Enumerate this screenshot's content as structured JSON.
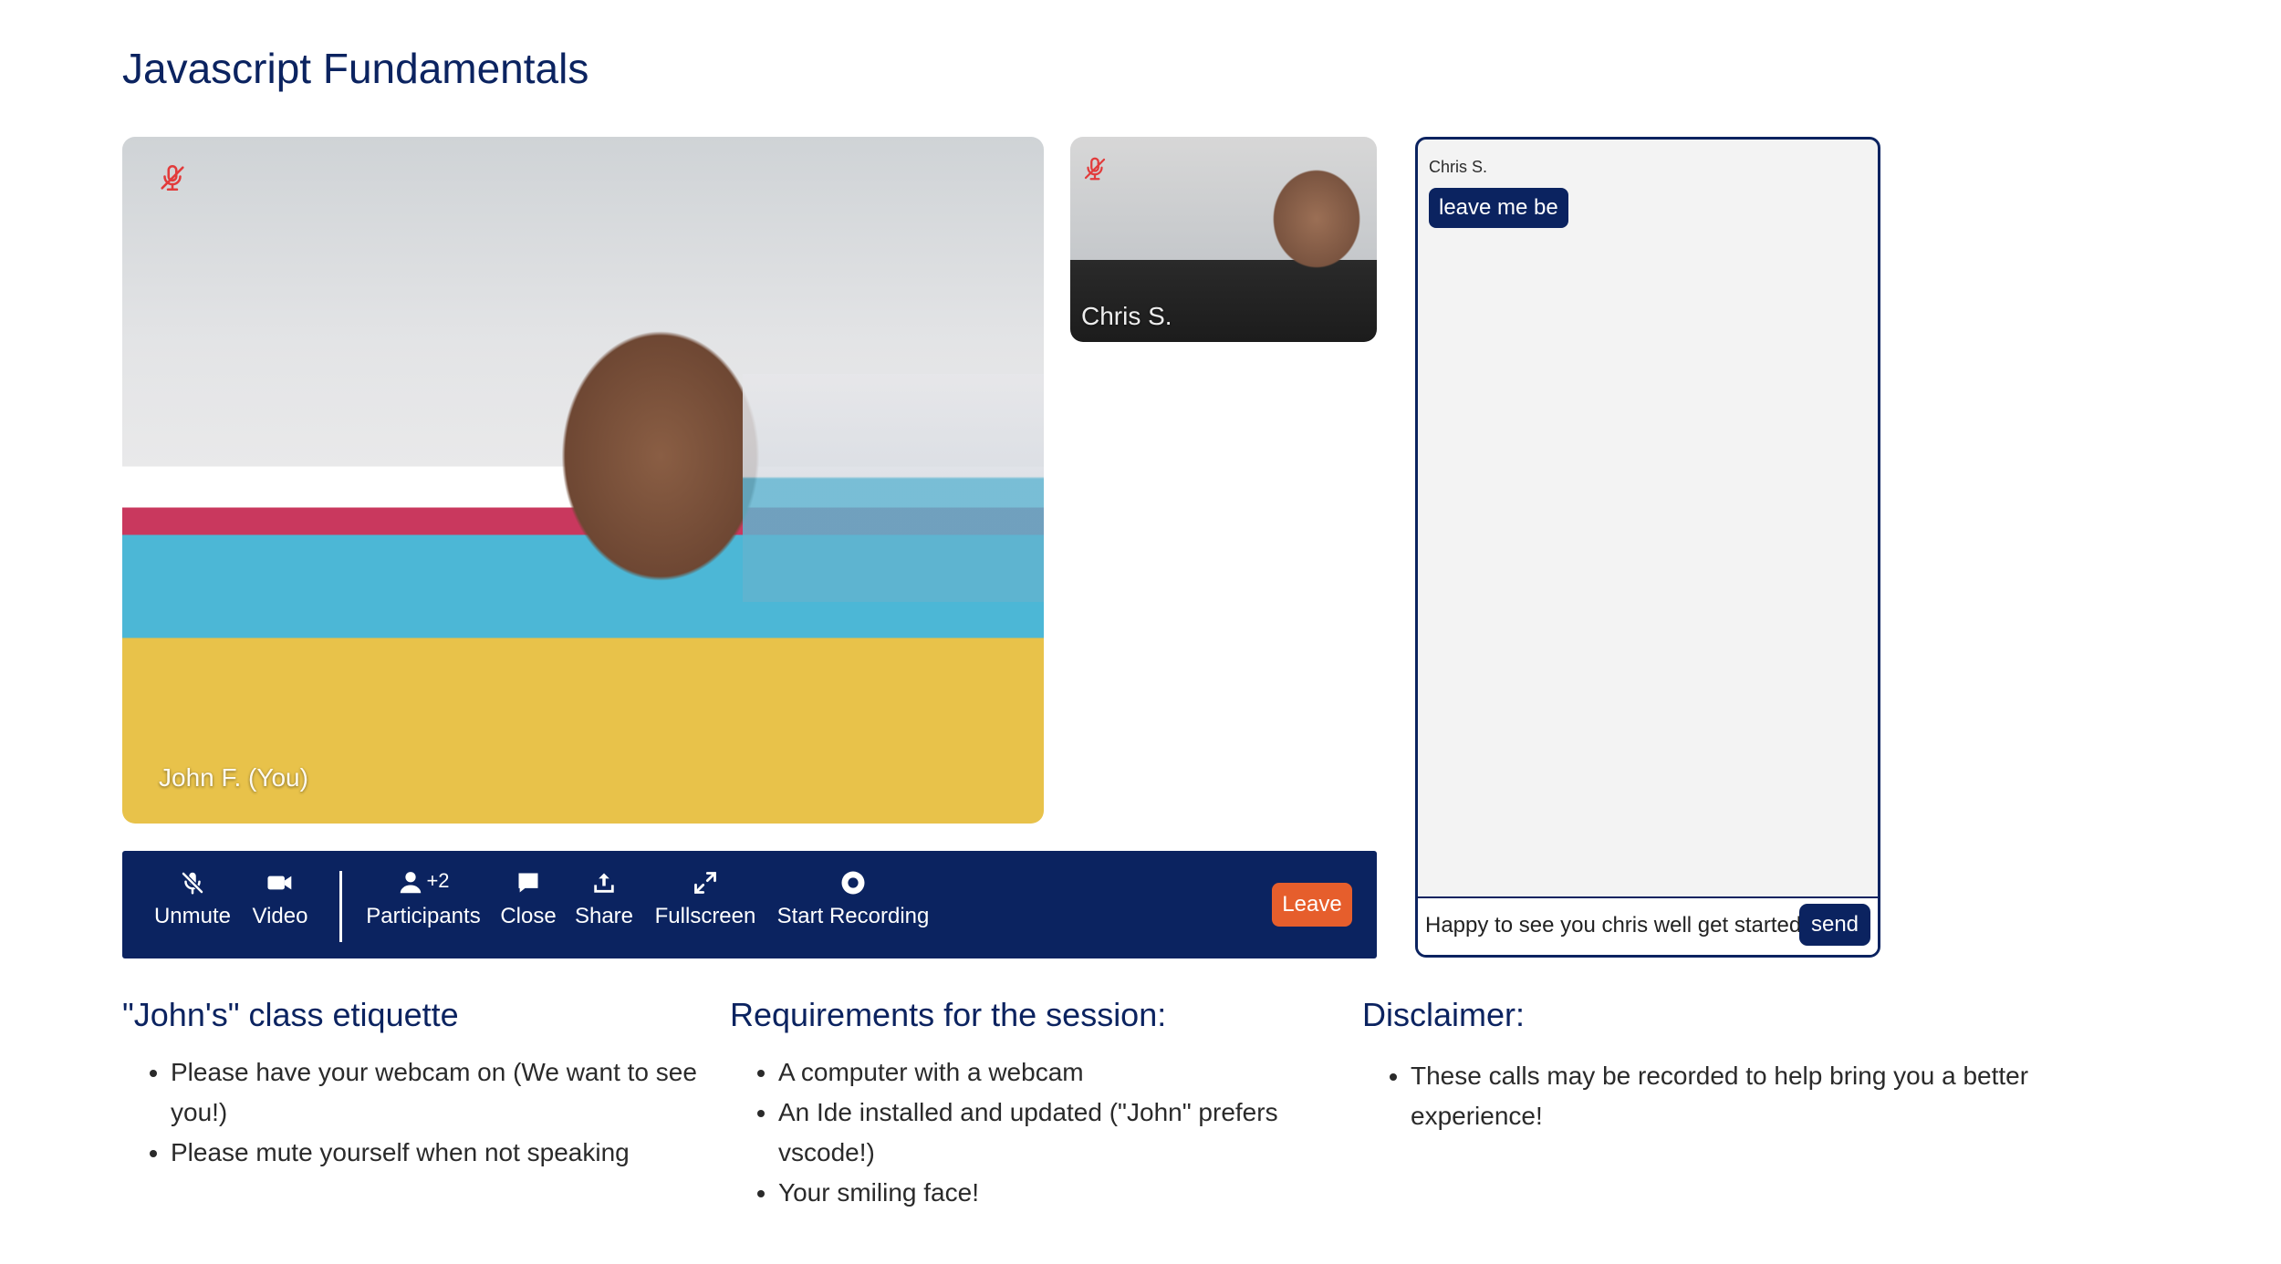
{
  "page": {
    "title": "Javascript Fundamentals"
  },
  "videos": {
    "main": {
      "label": "John F. (You)",
      "muted": true
    },
    "side": {
      "label": "Chris S.",
      "muted": true
    }
  },
  "toolbar": {
    "unmute_label": "Unmute",
    "video_label": "Video",
    "participants_label": "Participants",
    "participants_count": "+2",
    "close_label": "Close",
    "share_label": "Share",
    "fullscreen_label": "Fullscreen",
    "record_label": "Start Recording",
    "leave_label": "Leave"
  },
  "chat": {
    "messages": [
      {
        "sender": "Chris S.",
        "text": "leave me be"
      }
    ],
    "input_value": "Happy to see you chris well get started",
    "send_label": "send"
  },
  "sections": {
    "etiquette": {
      "heading": "\"John's\" class etiquette",
      "items": [
        "Please have your webcam on (We want to see you!)",
        "Please mute yourself when not speaking"
      ]
    },
    "requirements": {
      "heading": "Requirements for the session:",
      "items": [
        "A computer with a webcam",
        "An Ide installed and updated (\"John\" prefers vscode!)",
        "Your smiling face!"
      ]
    },
    "disclaimer": {
      "heading": "Disclaimer:",
      "items": [
        "These calls may be recorded to help bring you a better experience!"
      ]
    }
  },
  "colors": {
    "primary": "#0b2360",
    "leave": "#e65e2c",
    "muted_icon": "#e23b3b"
  },
  "icons": [
    "mic-muted-icon",
    "mic-off-icon",
    "video-camera-icon",
    "participants-icon",
    "chat-bubble-icon",
    "share-upload-icon",
    "expand-icon",
    "record-icon"
  ]
}
